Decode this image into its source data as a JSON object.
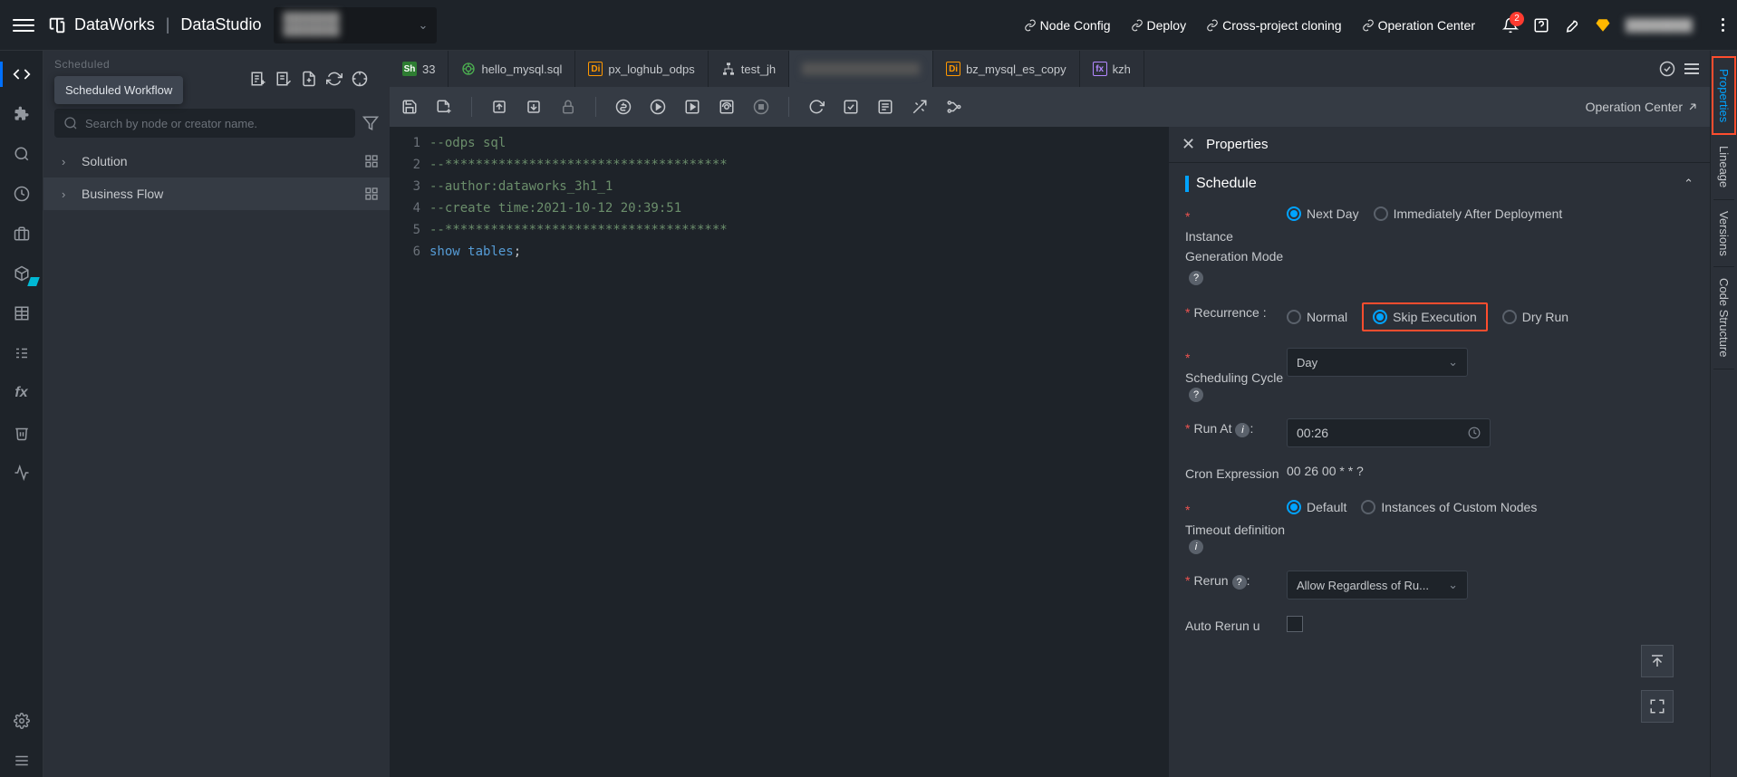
{
  "header": {
    "product": "DataWorks",
    "module": "DataStudio",
    "links": {
      "node_config": "Node Config",
      "deploy": "Deploy",
      "cross_project": "Cross-project cloning",
      "operation_center": "Operation Center"
    },
    "badge_count": "2"
  },
  "sidebar": {
    "faded_heading": "Scheduled",
    "tooltip": "Scheduled Workflow",
    "search_placeholder": "Search by node or creator name.",
    "tree": {
      "solution": "Solution",
      "business_flow": "Business Flow"
    }
  },
  "tabs": [
    {
      "kind": "sh",
      "label": "33"
    },
    {
      "kind": "sql",
      "label": "hello_mysql.sql"
    },
    {
      "kind": "di",
      "label": "px_loghub_odps"
    },
    {
      "kind": "flow",
      "label": "test_jh"
    },
    {
      "kind": "blur",
      "label": ""
    },
    {
      "kind": "di",
      "label": "bz_mysql_es_copy"
    },
    {
      "kind": "fx",
      "label": "kzh"
    }
  ],
  "editor_toolbar": {
    "right_link": "Operation Center"
  },
  "code_lines": [
    {
      "n": "1",
      "html": "<span class='c-comment'>--odps sql</span>"
    },
    {
      "n": "2",
      "html": "<span class='c-comment'>--*************************************</span>"
    },
    {
      "n": "3",
      "html": "<span class='c-comment'>--author:dataworks_3h1_1</span>"
    },
    {
      "n": "4",
      "html": "<span class='c-comment'>--create time:2021-10-12 20:39:51</span>"
    },
    {
      "n": "5",
      "html": "<span class='c-comment'>--*************************************</span>"
    },
    {
      "n": "6",
      "html": "<span class='c-kw'>show</span> <span class='c-kw'>tables</span><span class='c-punc'>;</span>"
    }
  ],
  "properties": {
    "panel_title": "Properties",
    "section_title": "Schedule",
    "instance_gen": {
      "label": "Instance Generation Mode",
      "next_day": "Next Day",
      "immediately": "Immediately After Deployment"
    },
    "recurrence": {
      "label": "Recurrence :",
      "normal": "Normal",
      "skip": "Skip Execution",
      "dry": "Dry Run"
    },
    "scheduling_cycle": {
      "label": "Scheduling Cycle",
      "value": "Day"
    },
    "run_at": {
      "label": "Run At",
      "value": "00:26"
    },
    "cron": {
      "label": "Cron Expression",
      "value": "00 26 00 * * ?"
    },
    "timeout": {
      "label": "Timeout definition",
      "default": "Default",
      "custom": "Instances of Custom Nodes"
    },
    "rerun": {
      "label": "Rerun",
      "value": "Allow Regardless of Ru..."
    },
    "auto_rerun": {
      "label": "Auto Rerun u"
    }
  },
  "right_tabs": {
    "properties": "Properties",
    "lineage": "Lineage",
    "versions": "Versions",
    "code_structure": "Code Structure"
  }
}
